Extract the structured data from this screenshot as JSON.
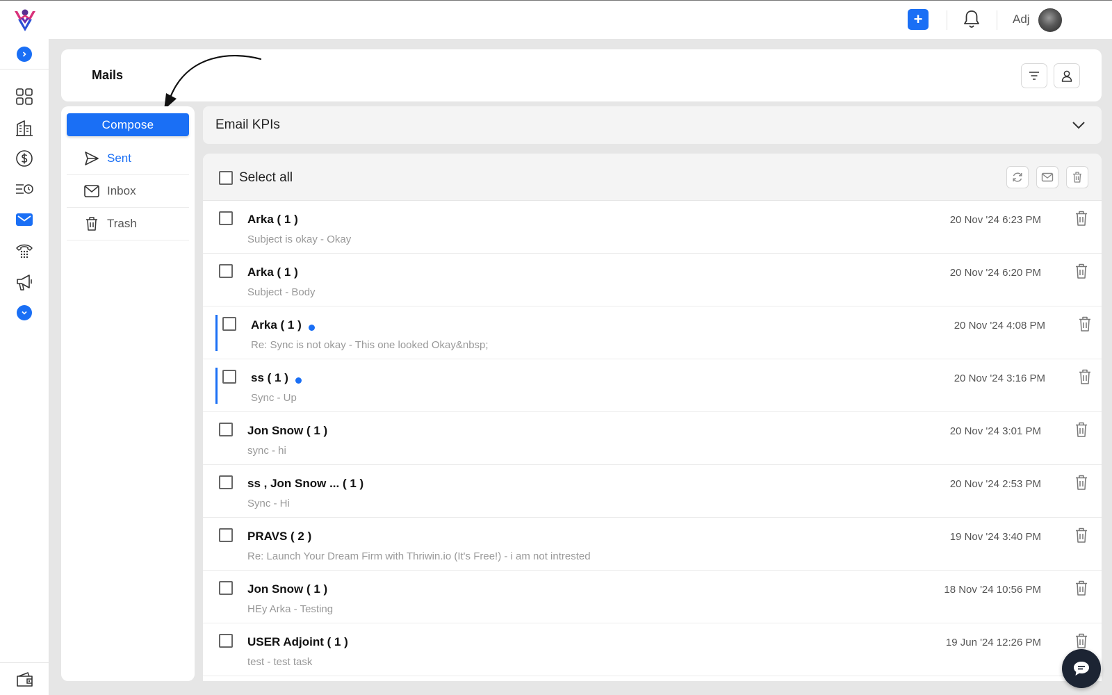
{
  "header": {
    "user_name": "Adj"
  },
  "page": {
    "title": "Mails"
  },
  "mail_nav": {
    "compose_label": "Compose",
    "items": [
      {
        "label": "Sent",
        "icon": "send-icon",
        "active": true
      },
      {
        "label": "Inbox",
        "icon": "mail-icon",
        "active": false
      },
      {
        "label": "Trash",
        "icon": "trash-icon",
        "active": false
      }
    ]
  },
  "kpi": {
    "label": "Email KPIs"
  },
  "list": {
    "select_all_label": "Select all",
    "rows": [
      {
        "sender": "Arka ( 1 )",
        "snippet": "Subject is okay -  Okay",
        "date": "20 Nov '24 6:23 PM",
        "unread": false
      },
      {
        "sender": "Arka ( 1 )",
        "snippet": "Subject -  Body",
        "date": "20 Nov '24 6:20 PM",
        "unread": false
      },
      {
        "sender": "Arka ( 1 )",
        "snippet": "Re: Sync is not okay -  This one looked Okay&nbsp;",
        "date": "20 Nov '24 4:08 PM",
        "unread": true
      },
      {
        "sender": "ss ( 1 )",
        "snippet": "Sync -  Up",
        "date": "20 Nov '24 3:16 PM",
        "unread": true
      },
      {
        "sender": "Jon Snow ( 1 )",
        "snippet": "sync -  hi",
        "date": "20 Nov '24 3:01 PM",
        "unread": false
      },
      {
        "sender": "ss ,   Jon Snow ... ( 1 )",
        "snippet": "Sync -  Hi",
        "date": "20 Nov '24 2:53 PM",
        "unread": false
      },
      {
        "sender": "PRAVS ( 2 )",
        "snippet": "Re: Launch Your Dream Firm with Thriwin.io (It's Free!) -  i am not intrested",
        "date": "19 Nov '24 3:40 PM",
        "unread": false
      },
      {
        "sender": "Jon Snow ( 1 )",
        "snippet": "HEy Arka -  Testing",
        "date": "18 Nov '24 10:56 PM",
        "unread": false
      },
      {
        "sender": "USER Adjoint ( 1 )",
        "snippet": "test -  test task",
        "date": "19 Jun '24 12:26 PM",
        "unread": false
      }
    ]
  },
  "colors": {
    "accent": "#1a6ff5",
    "background": "#e6e6e6",
    "chat_fab": "#1c2433"
  }
}
